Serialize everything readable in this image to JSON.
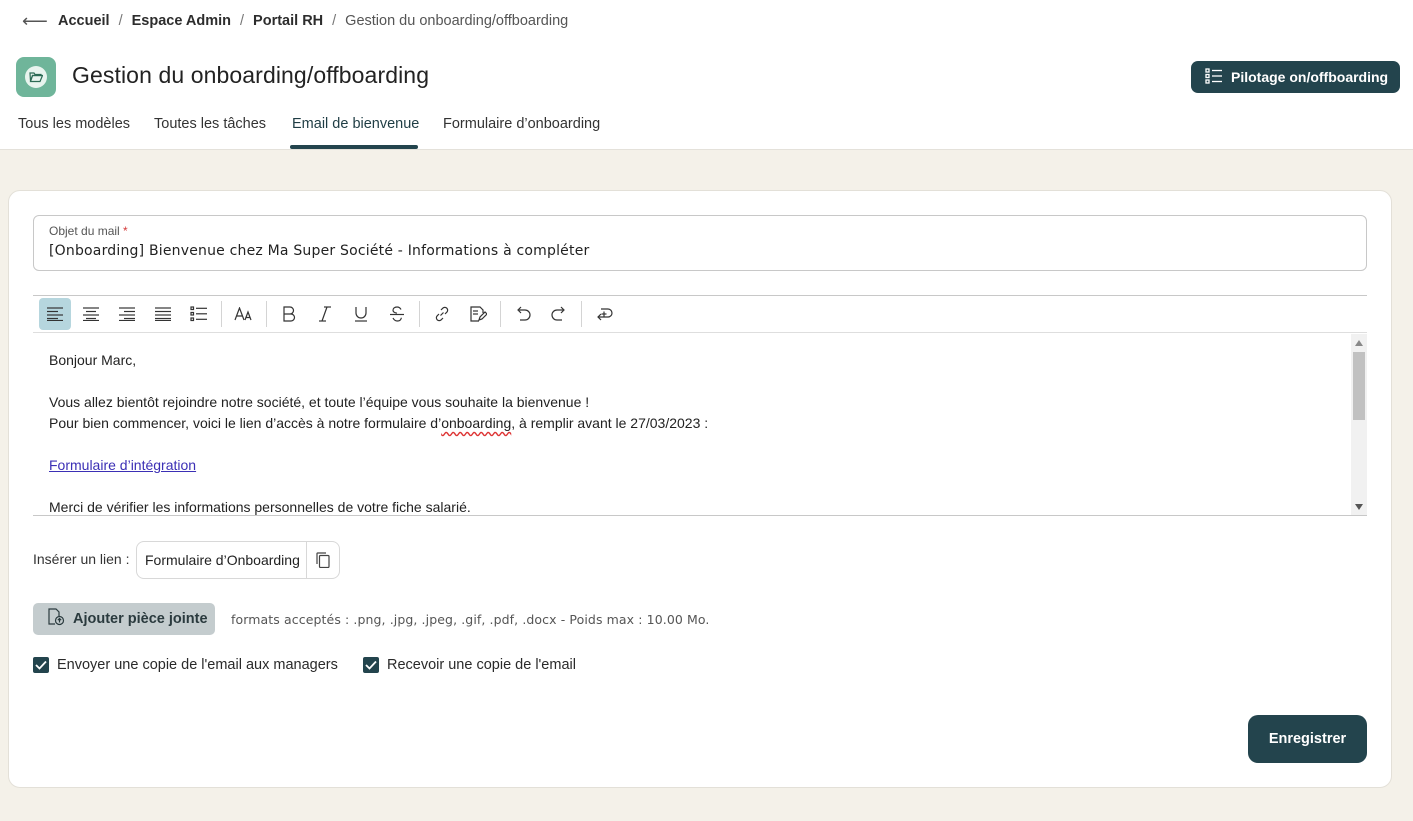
{
  "breadcrumb": {
    "back_icon": "arrow-left-icon",
    "back_glyph": "⟵",
    "items": [
      "Accueil",
      "Espace Admin",
      "Portail RH",
      "Gestion du onboarding/offboarding"
    ],
    "separator": "/"
  },
  "header": {
    "app_icon": "folder-open-icon",
    "title": "Gestion du onboarding/offboarding",
    "pilot_button": {
      "label": "Pilotage on/offboarding",
      "icon": "list-icon"
    }
  },
  "tabs": [
    {
      "label": "Tous les modèles",
      "active": false
    },
    {
      "label": "Toutes les tâches",
      "active": false
    },
    {
      "label": "Email de bienvenue",
      "active": true
    },
    {
      "label": "Formulaire d’onboarding",
      "active": false
    }
  ],
  "form": {
    "subject": {
      "label": "Objet du mail",
      "required_mark": "*",
      "value": "[Onboarding] Bienvenue chez Ma Super Société - Informations à compléter"
    },
    "toolbar": [
      "align-left-icon",
      "align-center-icon",
      "align-right-icon",
      "align-justify-icon",
      "bullet-list-icon",
      "font-size-icon",
      "bold-icon",
      "italic-icon",
      "underline-icon",
      "strikethrough-icon",
      "link-icon",
      "edit-document-icon",
      "undo-icon",
      "redo-icon",
      "insert-icon"
    ],
    "body": {
      "greeting": "Bonjour Marc,",
      "line1": "Vous allez bientôt rejoindre notre société, et toute l’équipe vous souhaite la bienvenue !",
      "line2_before": "Pour bien commencer, voici le lien d’accès à notre formulaire d’",
      "line2_misspelled": "onboarding",
      "line2_after": ", à remplir avant le 27/03/2023 :",
      "link_text": "Formulaire d’intégration",
      "line3": "Merci de vérifier les informations personnelles de votre fiche salarié."
    },
    "insert_link": {
      "label": "Insérer un lien :",
      "chip_text": "Formulaire d’Onboarding",
      "copy_icon": "copy-icon"
    },
    "attachment": {
      "button_label": "Ajouter pièce jointe",
      "icon": "attach-file-icon",
      "formats_text": "formats acceptés : .png, .jpg, .jpeg, .gif, .pdf, .docx - Poids max : 10.00 Mo."
    },
    "checkboxes": [
      {
        "label": "Envoyer une copie de l'email aux managers",
        "checked": true
      },
      {
        "label": "Recevoir une copie de l'email",
        "checked": true
      }
    ],
    "save_label": "Enregistrer"
  },
  "colors": {
    "primary": "#23444d",
    "accent": "#6fb59a",
    "background": "#f4f1e9",
    "active_tool": "#b6d6de"
  }
}
